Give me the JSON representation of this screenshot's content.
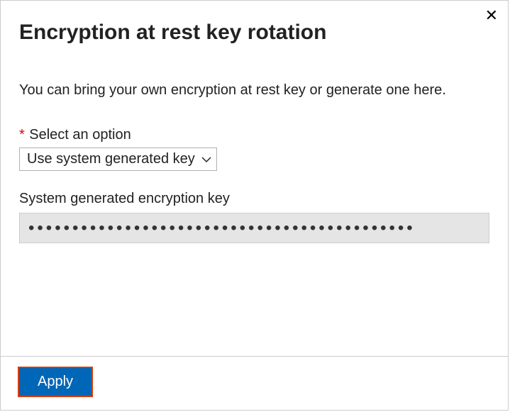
{
  "panel": {
    "title": "Encryption at rest key rotation",
    "description": "You can bring your own encryption at rest key or generate one here.",
    "option_label": "Select an option",
    "option_required_marker": "*",
    "option_selected": "Use system generated key",
    "key_label": "System generated encryption key",
    "key_value": "••••••••••••••••••••••••••••••••••••••••••••",
    "apply_label": "Apply"
  }
}
